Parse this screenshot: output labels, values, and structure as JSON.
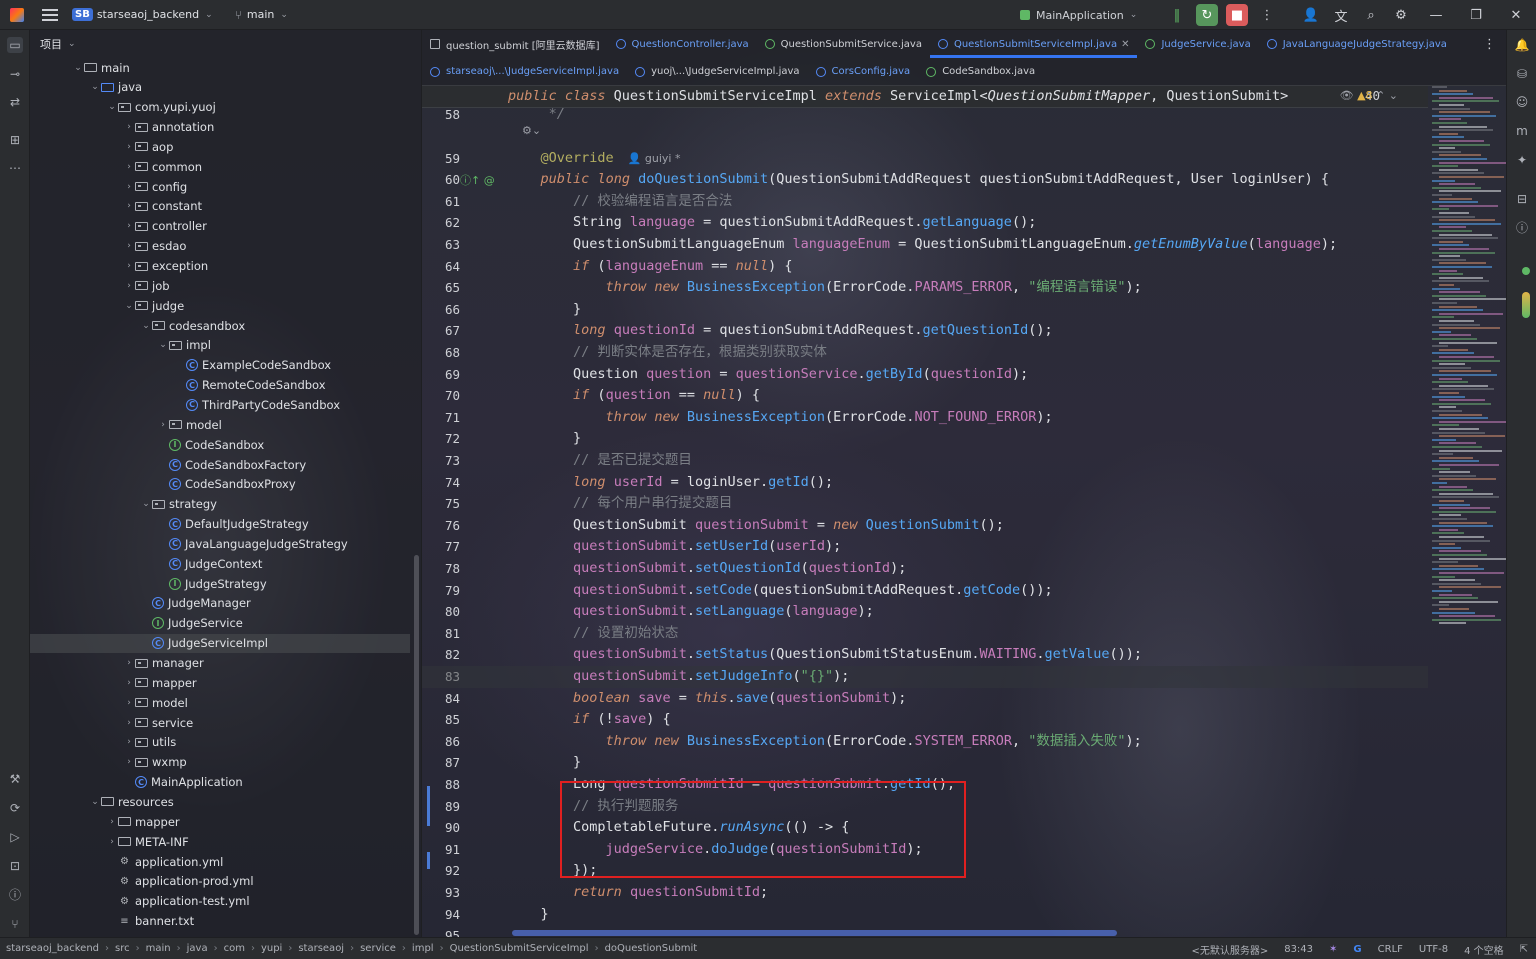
{
  "titlebar": {
    "project_badge": "SB",
    "project_name": "starseaoj_backend",
    "branch": "main",
    "run_config": "MainApplication"
  },
  "project_panel": {
    "title": "项目",
    "tree": [
      {
        "label": "main",
        "kind": "folder",
        "indent": 0,
        "open": true
      },
      {
        "label": "java",
        "kind": "folder-src",
        "indent": 1,
        "open": true
      },
      {
        "label": "com.yupi.yuoj",
        "kind": "pkg",
        "indent": 2,
        "open": true
      },
      {
        "label": "annotation",
        "kind": "pkg",
        "indent": 3,
        "open": false
      },
      {
        "label": "aop",
        "kind": "pkg",
        "indent": 3,
        "open": false
      },
      {
        "label": "common",
        "kind": "pkg",
        "indent": 3,
        "open": false
      },
      {
        "label": "config",
        "kind": "pkg",
        "indent": 3,
        "open": false
      },
      {
        "label": "constant",
        "kind": "pkg",
        "indent": 3,
        "open": false
      },
      {
        "label": "controller",
        "kind": "pkg",
        "indent": 3,
        "open": false
      },
      {
        "label": "esdao",
        "kind": "pkg",
        "indent": 3,
        "open": false
      },
      {
        "label": "exception",
        "kind": "pkg",
        "indent": 3,
        "open": false
      },
      {
        "label": "job",
        "kind": "pkg",
        "indent": 3,
        "open": false
      },
      {
        "label": "judge",
        "kind": "pkg",
        "indent": 3,
        "open": true
      },
      {
        "label": "codesandbox",
        "kind": "pkg",
        "indent": 4,
        "open": true
      },
      {
        "label": "impl",
        "kind": "pkg",
        "indent": 5,
        "open": true
      },
      {
        "label": "ExampleCodeSandbox",
        "kind": "class",
        "indent": 6
      },
      {
        "label": "RemoteCodeSandbox",
        "kind": "class",
        "indent": 6
      },
      {
        "label": "ThirdPartyCodeSandbox",
        "kind": "class",
        "indent": 6
      },
      {
        "label": "model",
        "kind": "pkg",
        "indent": 5,
        "open": false
      },
      {
        "label": "CodeSandbox",
        "kind": "iface",
        "indent": 5
      },
      {
        "label": "CodeSandboxFactory",
        "kind": "class",
        "indent": 5
      },
      {
        "label": "CodeSandboxProxy",
        "kind": "class",
        "indent": 5
      },
      {
        "label": "strategy",
        "kind": "pkg",
        "indent": 4,
        "open": true
      },
      {
        "label": "DefaultJudgeStrategy",
        "kind": "class",
        "indent": 5
      },
      {
        "label": "JavaLanguageJudgeStrategy",
        "kind": "class",
        "indent": 5
      },
      {
        "label": "JudgeContext",
        "kind": "class",
        "indent": 5
      },
      {
        "label": "JudgeStrategy",
        "kind": "iface",
        "indent": 5
      },
      {
        "label": "JudgeManager",
        "kind": "class",
        "indent": 4
      },
      {
        "label": "JudgeService",
        "kind": "iface",
        "indent": 4
      },
      {
        "label": "JudgeServiceImpl",
        "kind": "class",
        "indent": 4,
        "selected": true
      },
      {
        "label": "manager",
        "kind": "pkg",
        "indent": 3,
        "open": false
      },
      {
        "label": "mapper",
        "kind": "pkg",
        "indent": 3,
        "open": false
      },
      {
        "label": "model",
        "kind": "pkg",
        "indent": 3,
        "open": false
      },
      {
        "label": "service",
        "kind": "pkg",
        "indent": 3,
        "open": false
      },
      {
        "label": "utils",
        "kind": "pkg",
        "indent": 3,
        "open": false
      },
      {
        "label": "wxmp",
        "kind": "pkg",
        "indent": 3,
        "open": false
      },
      {
        "label": "MainApplication",
        "kind": "class",
        "indent": 3
      },
      {
        "label": "resources",
        "kind": "folder-res",
        "indent": 1,
        "open": true
      },
      {
        "label": "mapper",
        "kind": "folder",
        "indent": 2,
        "open": false
      },
      {
        "label": "META-INF",
        "kind": "folder",
        "indent": 2,
        "open": false
      },
      {
        "label": "application.yml",
        "kind": "yml",
        "indent": 2
      },
      {
        "label": "application-prod.yml",
        "kind": "yml",
        "indent": 2
      },
      {
        "label": "application-test.yml",
        "kind": "yml",
        "indent": 2
      },
      {
        "label": "banner.txt",
        "kind": "txt",
        "indent": 2
      }
    ]
  },
  "tabs_row1": [
    {
      "label": "question_submit [阿里云数据库]",
      "icon": "grid",
      "color": "normal"
    },
    {
      "label": "QuestionController.java",
      "icon": "class",
      "color": "blue"
    },
    {
      "label": "QuestionSubmitService.java",
      "icon": "iface",
      "color": "normal"
    },
    {
      "label": "QuestionSubmitServiceImpl.java",
      "icon": "class",
      "color": "blue",
      "active": true,
      "closable": true
    },
    {
      "label": "JudgeService.java",
      "icon": "iface",
      "color": "blue"
    },
    {
      "label": "JavaLanguageJudgeStrategy.java",
      "icon": "class",
      "color": "blue"
    }
  ],
  "tabs_row2": [
    {
      "label": "starseaoj\\...\\JudgeServiceImpl.java",
      "icon": "class",
      "color": "blue"
    },
    {
      "label": "yuoj\\...\\JudgeServiceImpl.java",
      "icon": "class",
      "color": "normal"
    },
    {
      "label": "CorsConfig.java",
      "icon": "class",
      "color": "blue"
    },
    {
      "label": "CodeSandbox.java",
      "icon": "iface",
      "color": "normal"
    }
  ],
  "editor": {
    "sticky_line_number": "40",
    "sticky_text": "public class QuestionSubmitServiceImpl extends ServiceImpl<QuestionSubmitMapper, QuestionSubmit>",
    "warnings": "▲8",
    "author_hint": "guiyi *",
    "current_line": 83,
    "lines": [
      {
        "n": "58",
        "html": "     <span class=\"cmt ital\">*/</span>"
      },
      {
        "n": "",
        "html": ""
      },
      {
        "n": "59",
        "html": "    <span class=\"ann\">@Override</span>"
      },
      {
        "n": "60",
        "html": "    <span class=\"k\">public</span> <span class=\"k\">long</span> <span class=\"fn\">doQuestionSubmit</span>(QuestionSubmitAddRequest questionSubmitAddRequest, User loginUser) {"
      },
      {
        "n": "61",
        "html": "        <span class=\"cmt\">// 校验编程语言是否合法</span>"
      },
      {
        "n": "62",
        "html": "        String <span class=\"fld\">language</span> = questionSubmitAddRequest.<span class=\"fn\">getLanguage</span>();"
      },
      {
        "n": "63",
        "html": "        QuestionSubmitLanguageEnum <span class=\"fld\">languageEnum</span> = QuestionSubmitLanguageEnum.<span class=\"fn ital\">getEnumByValue</span>(<span class=\"fld\">language</span>);"
      },
      {
        "n": "64",
        "html": "        <span class=\"k\">if</span> (<span class=\"fld\">languageEnum</span> == <span class=\"k\">null</span>) {"
      },
      {
        "n": "65",
        "html": "            <span class=\"k\">throw</span> <span class=\"k\">new</span> <span class=\"fn\">BusinessException</span>(ErrorCode.<span class=\"const\">PARAMS_ERROR</span>, <span class=\"str\">\"编程语言错误\"</span>);"
      },
      {
        "n": "66",
        "html": "        }"
      },
      {
        "n": "67",
        "html": "        <span class=\"k\">long</span> <span class=\"fld\">questionId</span> = questionSubmitAddRequest.<span class=\"fn\">getQuestionId</span>();"
      },
      {
        "n": "68",
        "html": "        <span class=\"cmt\">// 判断实体是否存在，根据类别获取实体</span>"
      },
      {
        "n": "69",
        "html": "        Question <span class=\"fld\">question</span> = <span class=\"fld\">questionService</span>.<span class=\"fn\">getById</span>(<span class=\"fld\">questionId</span>);"
      },
      {
        "n": "70",
        "html": "        <span class=\"k\">if</span> (<span class=\"fld\">question</span> == <span class=\"k\">null</span>) {"
      },
      {
        "n": "71",
        "html": "            <span class=\"k\">throw</span> <span class=\"k\">new</span> <span class=\"fn\">BusinessException</span>(ErrorCode.<span class=\"const\">NOT_FOUND_ERROR</span>);"
      },
      {
        "n": "72",
        "html": "        }"
      },
      {
        "n": "73",
        "html": "        <span class=\"cmt\">// 是否已提交题目</span>"
      },
      {
        "n": "74",
        "html": "        <span class=\"k\">long</span> <span class=\"fld\">userId</span> = loginUser.<span class=\"fn\">getId</span>();"
      },
      {
        "n": "75",
        "html": "        <span class=\"cmt\">// 每个用户串行提交题目</span>"
      },
      {
        "n": "76",
        "html": "        QuestionSubmit <span class=\"fld\">questionSubmit</span> = <span class=\"k\">new</span> <span class=\"fn\">QuestionSubmit</span>();"
      },
      {
        "n": "77",
        "html": "        <span class=\"fld\">questionSubmit</span>.<span class=\"fn\">setUserId</span>(<span class=\"fld\">userId</span>);"
      },
      {
        "n": "78",
        "html": "        <span class=\"fld\">questionSubmit</span>.<span class=\"fn\">setQuestionId</span>(<span class=\"fld\">questionId</span>);"
      },
      {
        "n": "79",
        "html": "        <span class=\"fld\">questionSubmit</span>.<span class=\"fn\">setCode</span>(questionSubmitAddRequest.<span class=\"fn\">getCode</span>());"
      },
      {
        "n": "80",
        "html": "        <span class=\"fld\">questionSubmit</span>.<span class=\"fn\">setLanguage</span>(<span class=\"fld\">language</span>);"
      },
      {
        "n": "81",
        "html": "        <span class=\"cmt\">// 设置初始状态</span>"
      },
      {
        "n": "82",
        "html": "        <span class=\"fld\">questionSubmit</span>.<span class=\"fn\">setStatus</span>(QuestionSubmitStatusEnum.<span class=\"const\">WAITING</span>.<span class=\"fn\">getValue</span>());"
      },
      {
        "n": "83",
        "html": "        <span class=\"fld\">questionSubmit</span>.<span class=\"fn\">setJudgeInfo</span>(<span class=\"str\">\"{}\"</span>);"
      },
      {
        "n": "84",
        "html": "        <span class=\"k\">boolean</span> <span class=\"fld\">save</span> = <span class=\"k\">this</span>.<span class=\"fn\">save</span>(<span class=\"fld\">questionSubmit</span>);"
      },
      {
        "n": "85",
        "html": "        <span class=\"k\">if</span> (!<span class=\"fld\">save</span>) {"
      },
      {
        "n": "86",
        "html": "            <span class=\"k\">throw</span> <span class=\"k\">new</span> <span class=\"fn\">BusinessException</span>(ErrorCode.<span class=\"const\">SYSTEM_ERROR</span>, <span class=\"str\">\"数据插入失败\"</span>);"
      },
      {
        "n": "87",
        "html": "        }"
      },
      {
        "n": "88",
        "html": "        Long <span class=\"fld\">questionSubmitId</span> = <span class=\"fld\">questionSubmit</span>.<span class=\"fn\">getId</span>();"
      },
      {
        "n": "89",
        "html": "        <span class=\"cmt\">// 执行判题服务</span>"
      },
      {
        "n": "90",
        "html": "        CompletableFuture.<span class=\"fn ital\">runAsync</span>(() -> {"
      },
      {
        "n": "91",
        "html": "            <span class=\"fld\">judgeService</span>.<span class=\"fn\">doJudge</span>(<span class=\"fld\">questionSubmitId</span>);"
      },
      {
        "n": "92",
        "html": "        });"
      },
      {
        "n": "93",
        "html": "        <span class=\"k\">return</span> <span class=\"fld\">questionSubmitId</span>;"
      },
      {
        "n": "94",
        "html": "    }"
      },
      {
        "n": "95",
        "html": ""
      }
    ]
  },
  "statusbar": {
    "crumbs": [
      "starseaoj_backend",
      "src",
      "main",
      "java",
      "com",
      "yupi",
      "starseaoj",
      "service",
      "impl",
      "QuestionSubmitServiceImpl",
      "doQuestionSubmit"
    ],
    "server": "<无默认服务器>",
    "position": "83:43",
    "line_sep": "CRLF",
    "encoding": "UTF-8",
    "indent": "4 个空格"
  },
  "colors": {
    "accent": "#3574f0",
    "highlight_box": "#e02020",
    "keyword": "#cf8e6d",
    "method": "#56a8f5",
    "field": "#c77dbb",
    "string": "#6aab73",
    "comment": "#7a7e85"
  }
}
